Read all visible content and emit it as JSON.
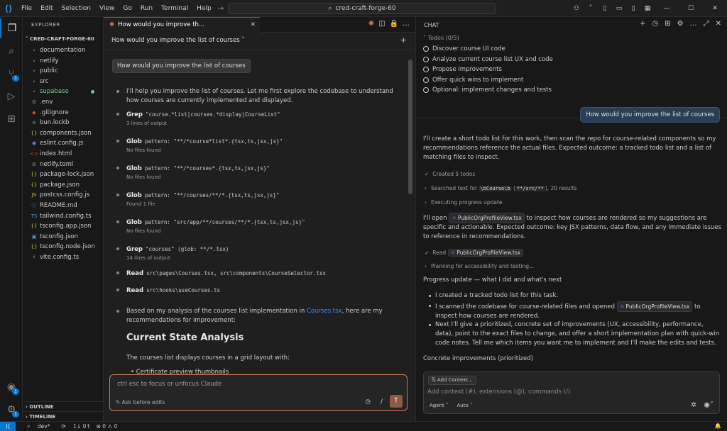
{
  "titlebar": {
    "menu": [
      "File",
      "Edit",
      "Selection",
      "View",
      "Go",
      "Run",
      "Terminal",
      "Help"
    ],
    "command_center": "cred-craft-forge-60",
    "icons": [
      "search-icon",
      "copilot-icon",
      "layout-icon",
      "minimize-icon",
      "maximize-icon",
      "close-icon"
    ]
  },
  "activity": {
    "badge_scm": "1",
    "badge_accounts": "1",
    "badge_settings": "1"
  },
  "explorer": {
    "header": "EXPLORER",
    "root": "CRED-CRAFT-FORGE-60",
    "items": [
      {
        "label": "documentation",
        "type": "folder"
      },
      {
        "label": "netlify",
        "type": "folder"
      },
      {
        "label": "public",
        "type": "folder"
      },
      {
        "label": "src",
        "type": "folder"
      },
      {
        "label": "supabase",
        "type": "folder",
        "modified": true
      },
      {
        "label": ".env",
        "type": "gear"
      },
      {
        "label": ".gitignore",
        "type": "git"
      },
      {
        "label": "bun.lockb",
        "type": "file"
      },
      {
        "label": "components.json",
        "type": "json"
      },
      {
        "label": "eslint.config.js",
        "type": "eslint"
      },
      {
        "label": "index.html",
        "type": "html"
      },
      {
        "label": "netlify.toml",
        "type": "gear"
      },
      {
        "label": "package-lock.json",
        "type": "json"
      },
      {
        "label": "package.json",
        "type": "json"
      },
      {
        "label": "postcss.config.js",
        "type": "js"
      },
      {
        "label": "README.md",
        "type": "info"
      },
      {
        "label": "tailwind.config.ts",
        "type": "ts"
      },
      {
        "label": "tsconfig.app.json",
        "type": "json"
      },
      {
        "label": "tsconfig.json",
        "type": "tsconfig"
      },
      {
        "label": "tsconfig.node.json",
        "type": "json"
      },
      {
        "label": "vite.config.ts",
        "type": "vite"
      }
    ],
    "outline": "OUTLINE",
    "timeline": "TIMELINE"
  },
  "editor": {
    "tab_label": "How would you improve th...",
    "sub_header": "How would you improve the list of courses",
    "user_message": "How would you improve the list of courses",
    "intro": "I'll help you improve the list of courses. Let me first explore the codebase to understand how courses are currently implemented and displayed.",
    "tools": [
      {
        "name": "Grep",
        "args": "\"course.*list|courses.*display|CourseList\"",
        "sub": "3 lines of output"
      },
      {
        "name": "Glob",
        "args": "pattern: \"**/*course*list*.{tsx,ts,jsx,js}\"",
        "sub": "No files found"
      },
      {
        "name": "Glob",
        "args": "pattern: \"**/*courses*.{tsx,ts,jsx,js}\"",
        "sub": "No files found"
      },
      {
        "name": "Glob",
        "args": "pattern: \"**/courses/**/*.{tsx,ts,jsx,js}\"",
        "sub": "Found 1 file"
      },
      {
        "name": "Glob",
        "args": "pattern: \"src/app/**/courses/**/*.{tsx,ts,jsx,js}\"",
        "sub": "No files found"
      },
      {
        "name": "Grep",
        "args": "\"courses\" (glob: **/*.tsx)",
        "sub": "14 lines of output"
      },
      {
        "name": "Read",
        "args": "src\\pages\\Courses.tsx, src\\components\\CourseSelector.tsx",
        "sub": ""
      },
      {
        "name": "Read",
        "args": "src\\hooks\\useCourses.ts",
        "sub": ""
      }
    ],
    "analysis_pre": "Based on my analysis of the courses list implementation in ",
    "analysis_link": "Courses.tsx",
    "analysis_post": ", here are my recommendations for improvement:",
    "heading": "Current State Analysis",
    "state_text": "The courses list displays courses in a grid layout with:",
    "state_bullet": "Certificate preview thumbnails",
    "input_placeholder": "ctrl esc to focus or unfocus Claude",
    "ask_label": "Ask before edits",
    "slash": "/"
  },
  "chat": {
    "title": "CHAT",
    "todos_header": "Todos (0/5)",
    "todos": [
      "Discover course UI code",
      "Analyze current course list UX and code",
      "Propose improvements",
      "Offer quick wins to implement",
      "Optional: implement changes and tests"
    ],
    "user_message": "How would you improve the list of courses",
    "p1": "I'll create a short todo list for this work, then scan the repo for course-related components so my recommendations reference the actual files. Expected outcome: a tracked todo list and a list of matching files to inspect.",
    "created": "Created 5 todos",
    "searched_pre": "Searched text for ",
    "searched_code1": "\\bCourse\\b",
    "searched_code2": "**/src/**",
    "searched_post": ", 20 results",
    "executing": "Executing progress update",
    "p2_pre": "I'll open ",
    "file_chip": "PublicOrgProfileView.tsx",
    "p2_post": " to inspect how courses are rendered so my suggestions are specific and actionable. Expected outcome: key JSX patterns, data flow, and any immediate issues to reference in recommendations.",
    "read_label": "Read",
    "planning": "Planning for accessibility and testing...",
    "progress_title": "Progress update — what I did and what's next",
    "b1": "I created a tracked todo list for this task.",
    "b2_pre": "I scanned the codebase for course-related files and opened ",
    "b2_post": " to inspect how courses are rendered.",
    "b3": "Next I'll give a prioritized, concrete set of improvements (UX, accessibility, performance, data), point to the exact files to change, and offer a short implementation plan with quick-win code notes. Tell me which items you want me to implement and I'll make the edits and tests.",
    "concrete": "Concrete improvements (prioritized)",
    "add_context": "Add Context...",
    "input_placeholder": "Add context (#), extensions (@), commands (/)",
    "agent": "Agent",
    "auto": "Auto"
  },
  "status": {
    "branch": "dev*",
    "sync": "1↓ 0↑",
    "problems": "⊗ 0 ⚠ 0"
  }
}
